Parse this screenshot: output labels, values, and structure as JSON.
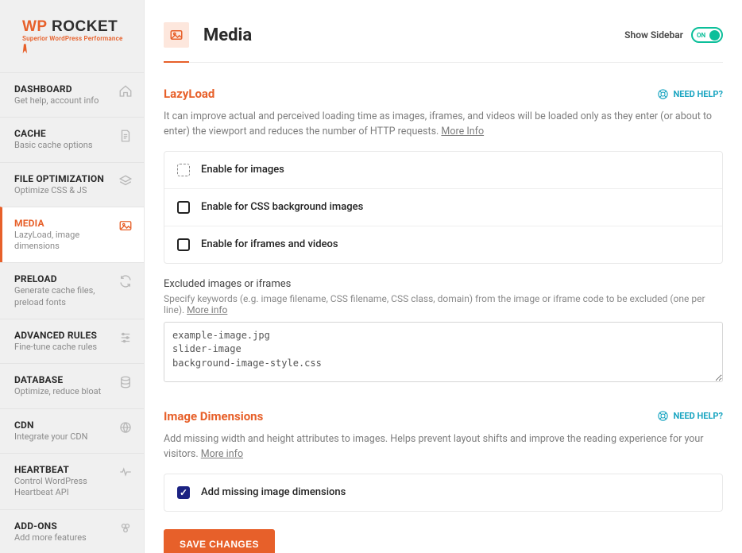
{
  "brand": {
    "wp": "WP",
    "rocket": " ROCKET",
    "tagline": "Superior WordPress Performance"
  },
  "nav": [
    {
      "id": "dashboard",
      "title": "DASHBOARD",
      "desc": "Get help, account info"
    },
    {
      "id": "cache",
      "title": "CACHE",
      "desc": "Basic cache options"
    },
    {
      "id": "fileopt",
      "title": "FILE OPTIMIZATION",
      "desc": "Optimize CSS & JS"
    },
    {
      "id": "media",
      "title": "MEDIA",
      "desc": "LazyLoad, image dimensions"
    },
    {
      "id": "preload",
      "title": "PRELOAD",
      "desc": "Generate cache files, preload fonts"
    },
    {
      "id": "advanced",
      "title": "ADVANCED RULES",
      "desc": "Fine-tune cache rules"
    },
    {
      "id": "database",
      "title": "DATABASE",
      "desc": "Optimize, reduce bloat"
    },
    {
      "id": "cdn",
      "title": "CDN",
      "desc": "Integrate your CDN"
    },
    {
      "id": "heartbeat",
      "title": "HEARTBEAT",
      "desc": "Control WordPress Heartbeat API"
    },
    {
      "id": "addons",
      "title": "ADD-ONS",
      "desc": "Add more features"
    }
  ],
  "header": {
    "title": "Media",
    "show_sidebar_label": "Show Sidebar",
    "toggle_state": "ON"
  },
  "lazyload": {
    "title": "LazyLoad",
    "need_help": "NEED HELP?",
    "desc": "It can improve actual and perceived loading time as images, iframes, and videos will be loaded only as they enter (or about to enter) the viewport and reduces the number of HTTP requests. ",
    "more_info": "More Info",
    "opts": {
      "images": "Enable for images",
      "cssbg": "Enable for CSS background images",
      "iframes": "Enable for iframes and videos"
    },
    "excluded_title": "Excluded images or iframes",
    "excluded_hint": "Specify keywords (e.g. image filename, CSS filename, CSS class, domain) from the image or iframe code to be excluded (one per line). ",
    "excluded_more": "More info",
    "excluded_value": "example-image.jpg\nslider-image\nbackground-image-style.css"
  },
  "imgdim": {
    "title": "Image Dimensions",
    "need_help": "NEED HELP?",
    "desc": "Add missing width and height attributes to images. Helps prevent layout shifts and improve the reading experience for your visitors. ",
    "more_info": "More info",
    "opt_label": "Add missing image dimensions"
  },
  "save_label": "SAVE CHANGES"
}
